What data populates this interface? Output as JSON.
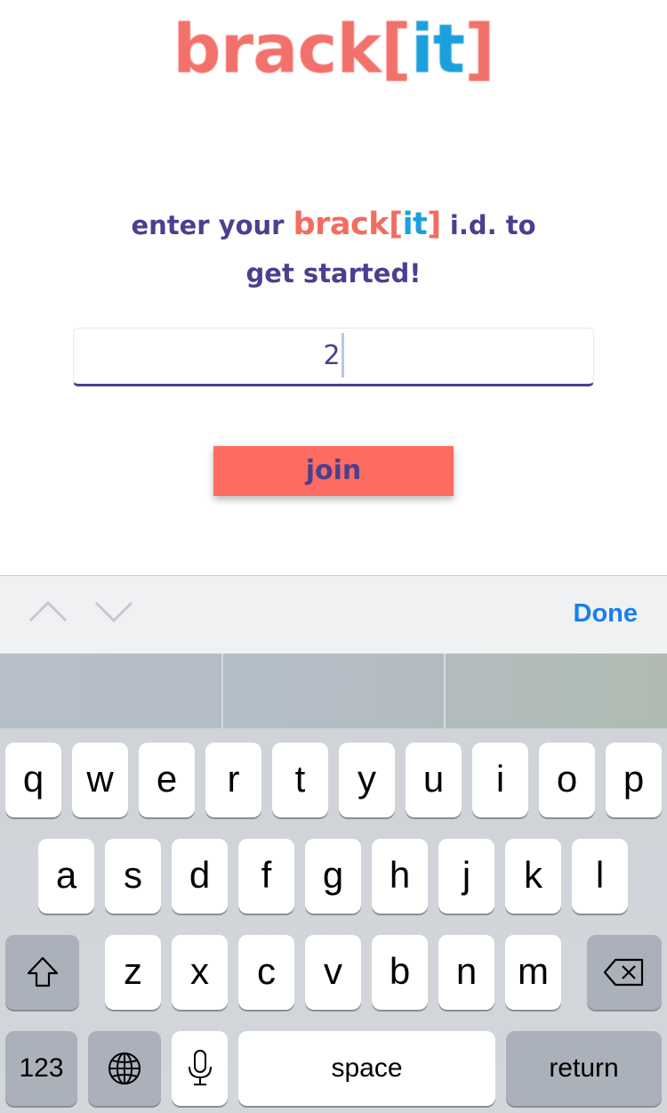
{
  "app": {
    "logo": {
      "part1": "brack",
      "bracket_open": "[",
      "part2": "it",
      "bracket_close": "]"
    },
    "prompt": {
      "line1_pre": "enter your",
      "brand1": "brack",
      "brand_open": "[",
      "brand2": "it",
      "brand_close": "]",
      "line1_post": "i.d. to",
      "line2": "get started!"
    },
    "id_input": {
      "value": "2"
    },
    "join_label": "join",
    "colors": {
      "coral": "#fe6b61",
      "purple": "#4b3f8f",
      "blue": "#1ca0dc"
    }
  },
  "toolbar": {
    "prev_icon": "chevron-up-icon",
    "next_icon": "chevron-down-icon",
    "done_label": "Done"
  },
  "keyboard": {
    "row1": [
      "q",
      "w",
      "e",
      "r",
      "t",
      "y",
      "u",
      "i",
      "o",
      "p"
    ],
    "row2": [
      "a",
      "s",
      "d",
      "f",
      "g",
      "h",
      "j",
      "k",
      "l"
    ],
    "row3": [
      "z",
      "x",
      "c",
      "v",
      "b",
      "n",
      "m"
    ],
    "shift_icon": "shift-icon",
    "delete_icon": "delete-icon",
    "numbers_label": "123",
    "globe_icon": "globe-icon",
    "mic_icon": "microphone-icon",
    "space_label": "space",
    "return_label": "return"
  }
}
